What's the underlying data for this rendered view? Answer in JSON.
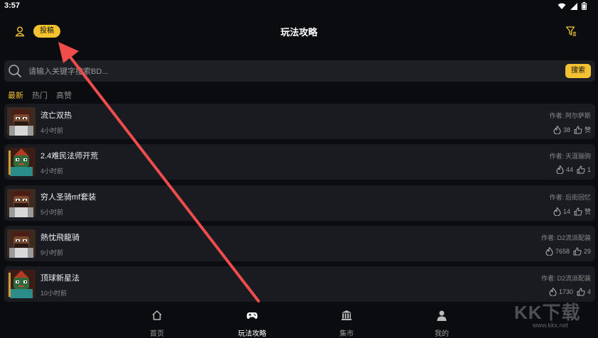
{
  "status": {
    "time": "3:57"
  },
  "header": {
    "title": "玩法攻略",
    "submit_label": "投稿"
  },
  "search": {
    "placeholder": "请输入关键字搜索BD...",
    "button_label": "搜索"
  },
  "tabs": [
    {
      "label": "最新",
      "active": true
    },
    {
      "label": "热门",
      "active": false
    },
    {
      "label": "高赞",
      "active": false
    }
  ],
  "posts": [
    {
      "title": "流亡双热",
      "time": "4小时前",
      "author_prefix": "作者:",
      "author": "阿尔萨斯",
      "views": "38",
      "likes": "赞",
      "avatar": "warrior"
    },
    {
      "title": "2.4难民法师开荒",
      "time": "4小时前",
      "author_prefix": "作者:",
      "author": "天涯骊驹",
      "views": "44",
      "likes": "1",
      "avatar": "mage"
    },
    {
      "title": "穷人圣骑mf套装",
      "time": "5小时前",
      "author_prefix": "作者:",
      "author": "后街回忆",
      "views": "14",
      "likes": "赞",
      "avatar": "warrior"
    },
    {
      "title": "熱忱飛龍骑",
      "time": "9小时前",
      "author_prefix": "作者:",
      "author": "D2流派配装",
      "views": "7658",
      "likes": "29",
      "avatar": "warrior"
    },
    {
      "title": "顶球新星法",
      "time": "10小时前",
      "author_prefix": "作者:",
      "author": "D2流派配装",
      "views": "1730",
      "likes": "4",
      "avatar": "mage"
    }
  ],
  "nav": [
    {
      "label": "首页",
      "icon": "home-icon",
      "active": false
    },
    {
      "label": "玩法攻略",
      "icon": "gamepad-icon",
      "active": true
    },
    {
      "label": "集市",
      "icon": "bank-icon",
      "active": false
    },
    {
      "label": "我的",
      "icon": "person-icon",
      "active": false
    }
  ],
  "watermark": {
    "text": "KK下载",
    "url": "www.kkx.net"
  },
  "colors": {
    "accent": "#f2c230",
    "background": "#0b0c10",
    "card": "#1a1b20",
    "annotation_arrow": "#ef4c4c"
  }
}
